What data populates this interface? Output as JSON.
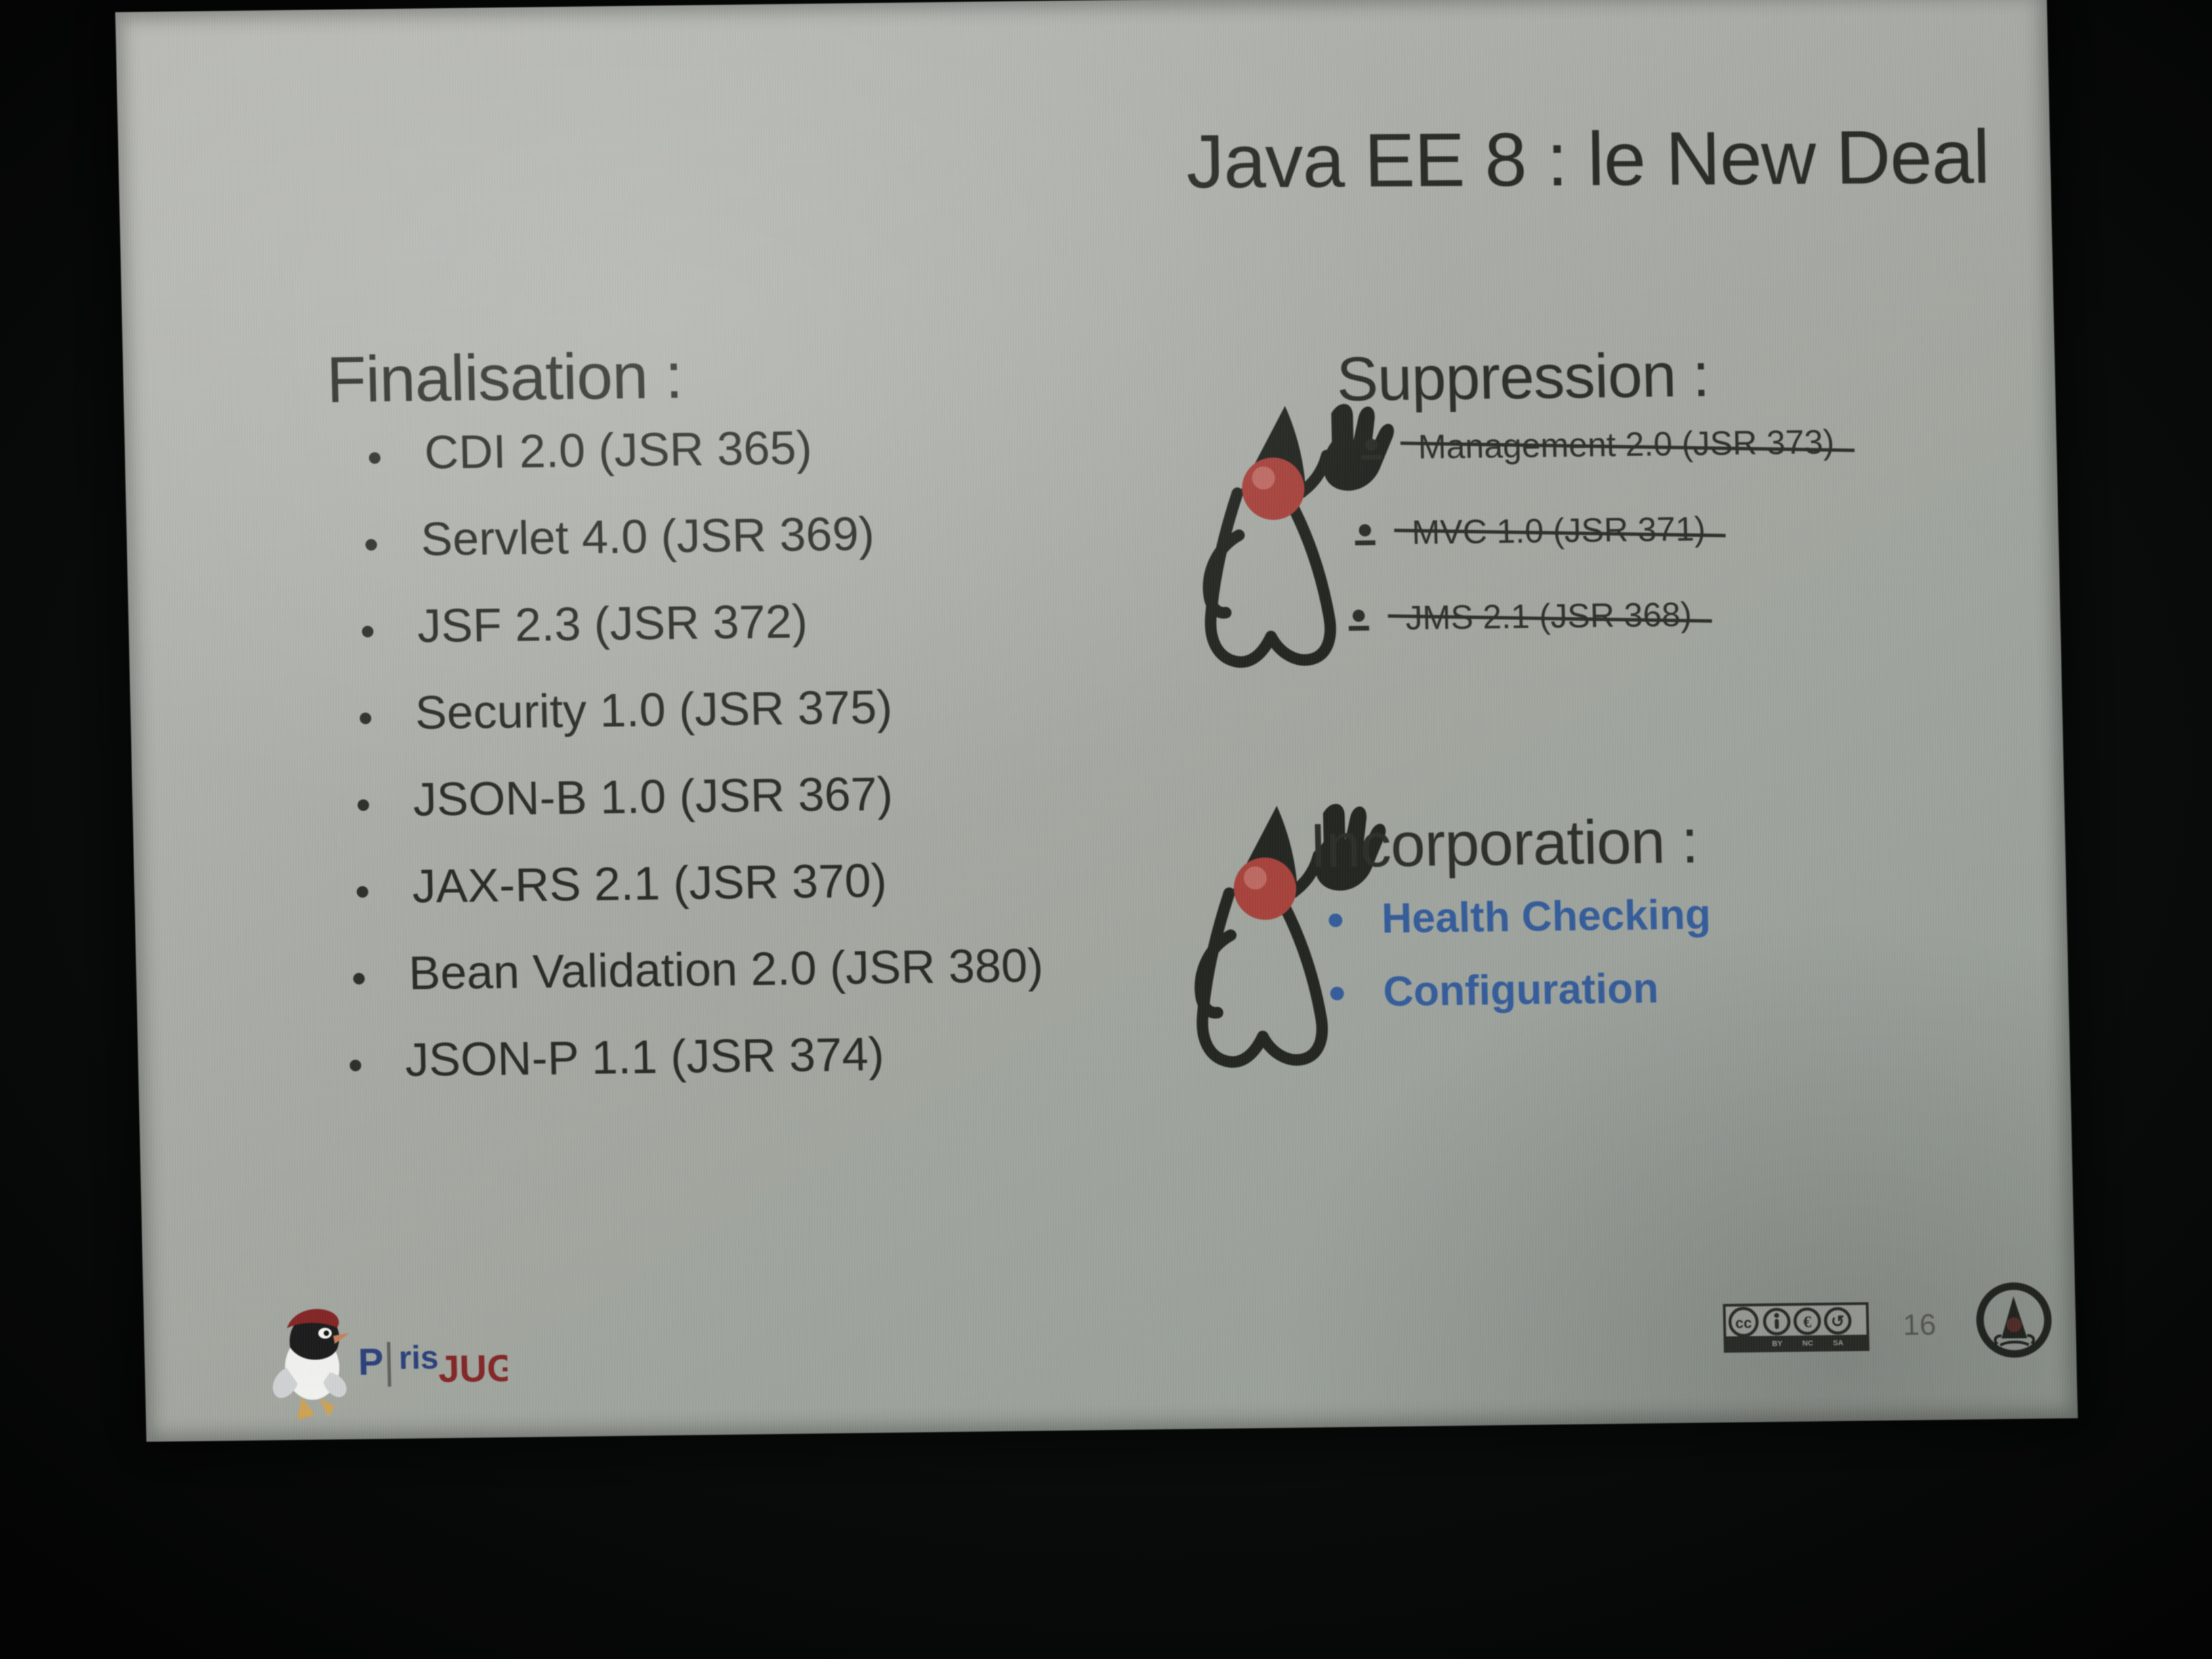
{
  "slide": {
    "title": "Java EE 8 : le New Deal",
    "page_number": "16",
    "colors": {
      "ink": "#262b21",
      "accent_blue": "#1c5ec2",
      "duke_nose_red": "#d8342a",
      "slide_bg": "#a9ada4",
      "room_bg": "#050705"
    },
    "finalisation": {
      "heading": "Finalisation :",
      "items": [
        "CDI 2.0 (JSR 365)",
        "Servlet 4.0 (JSR 369)",
        "JSF 2.3 (JSR 372)",
        "Security 1.0 (JSR 375)",
        "JSON-B 1.0 (JSR 367)",
        "JAX-RS 2.1 (JSR 370)",
        "Bean Validation 2.0 (JSR 380)",
        "JSON-P 1.1 (JSR 374)"
      ]
    },
    "suppression": {
      "heading": "Suppression :",
      "items": [
        "Management 2.0 (JSR 373)",
        "MVC 1.0 (JSR 371)",
        "JMS 2.1 (JSR 368)"
      ]
    },
    "incorporation": {
      "heading": "Incorporation :",
      "items": [
        "Health Checking",
        "Configuration"
      ]
    },
    "footer": {
      "jug_logo_letter": "P",
      "jug_logo_word_1": "ris",
      "jug_logo_word_2": "JUG",
      "cc_label": "cc",
      "cc_terms": [
        "BY",
        "NC",
        "SA"
      ]
    }
  }
}
